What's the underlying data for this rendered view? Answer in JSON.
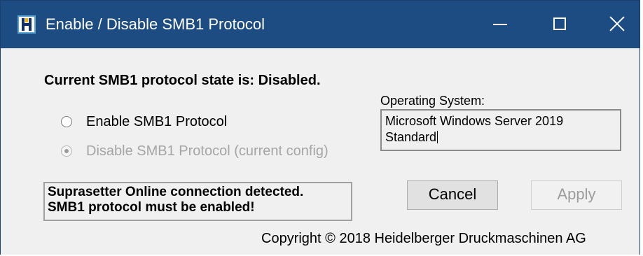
{
  "window": {
    "title": "Enable / Disable SMB1 Protocol",
    "titlebar_color": "#1c4c82",
    "icon": "heidelberg-h-icon",
    "controls": [
      "minimize-icon",
      "maximize-icon",
      "close-icon"
    ]
  },
  "status": {
    "text": "Current SMB1 protocol state is: Disabled."
  },
  "options": {
    "enable_label": "Enable SMB1 Protocol",
    "disable_label": "Disable SMB1 Protocol (current config)",
    "selected": "disable",
    "disable_enabled": false
  },
  "os": {
    "label": "Operating System:",
    "value": "Microsoft Windows Server 2019 Standard"
  },
  "warning": {
    "line1": "Suprasetter Online connection detected.",
    "line2": "SMB1 protocol must be enabled!"
  },
  "buttons": {
    "cancel": "Cancel",
    "apply": "Apply",
    "apply_enabled": false
  },
  "footer": {
    "copyright": "Copyright © 2018 Heidelberger Druckmaschinen AG"
  }
}
